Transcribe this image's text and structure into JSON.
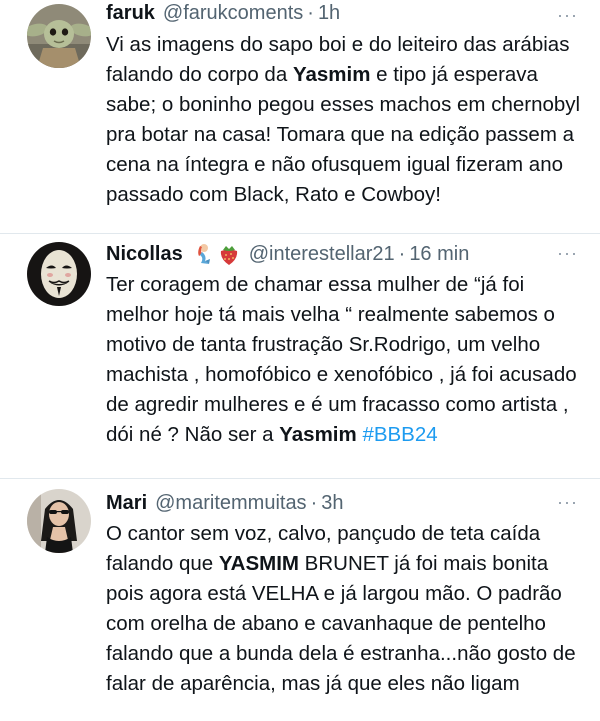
{
  "tweets": [
    {
      "name": "faruk",
      "handle": "@farukcoments",
      "time": "1h",
      "avatar": "avatar-grogu",
      "text": [
        "Vi as imagens do sapo boi e do leiteiro das arábias falando do corpo da ",
        {
          "bold": "Yasmim"
        },
        " e tipo já esperava sabe; o boninho pegou esses machos em chernobyl pra botar na casa! Tomara que na edição passem a cena na íntegra e não ofusquem igual fizeram ano passado com Black, Rato e Cowboy!"
      ]
    },
    {
      "name": "Nicollas",
      "emojis": [
        "mermaid-emoji",
        "strawberry-emoji"
      ],
      "handle": "@interestellar21",
      "time": "16 min",
      "avatar": "avatar-guy-fawkes-mask",
      "text": [
        "Ter coragem de chamar essa mulher de “já foi melhor hoje tá mais velha “ realmente sabemos o motivo de tanta frustração Sr.Rodrigo, um velho machista , homofóbico e xenofóbico , já foi acusado de agredir mulheres e é um fracasso como artista , dói né ? Não ser a ",
        {
          "bold": "Yasmim"
        },
        " ",
        {
          "hashtag": "#BBB24"
        }
      ]
    },
    {
      "name": "Mari",
      "handle": "@maritemmuitas",
      "time": "3h",
      "avatar": "avatar-woman-photo",
      "text": [
        "O cantor sem voz, calvo, pançudo de teta caída falando que ",
        {
          "bold": "YASMIM"
        },
        " BRUNET já foi mais bonita pois agora está VELHA e já largou mão. O padrão com orelha de abano e cavanhaque de pentelho falando que a bunda dela é estranha...não gosto de falar de aparência, mas já que eles não ligam"
      ]
    }
  ],
  "separator": "·",
  "more_icon": "···",
  "colors": {
    "text": "#0f1419",
    "secondary": "#536471",
    "hashtag": "#1d9bf0",
    "divider": "#e1e8ed"
  }
}
